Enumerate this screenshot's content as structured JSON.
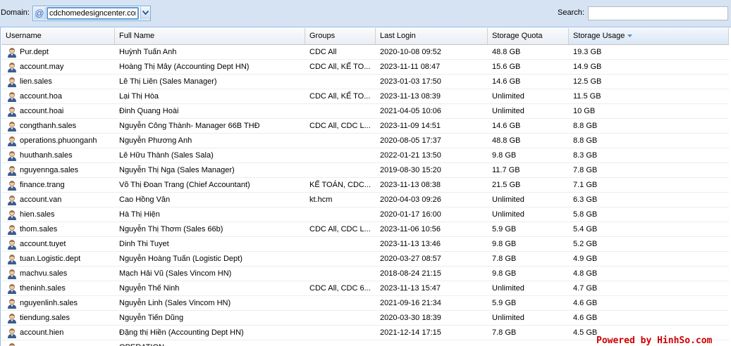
{
  "toolbar": {
    "domain_label": "Domain:",
    "domain_value": "cdchomedesigncenter.com",
    "search_label": "Search:",
    "search_value": ""
  },
  "grid": {
    "columns": {
      "username": "Username",
      "full_name": "Full Name",
      "groups": "Groups",
      "last_login": "Last Login",
      "storage_quota": "Storage Quota",
      "storage_usage": "Storage Usage"
    },
    "sorted_column": "storage_usage",
    "sort_direction": "descending",
    "rows": [
      {
        "username": "Pur.dept",
        "full_name": "Huỳnh Tuấn Anh",
        "groups": "CDC All",
        "last_login": "2020-10-08 09:52",
        "quota": "48.8 GB",
        "usage": "19.3 GB"
      },
      {
        "username": "account.may",
        "full_name": "Hoàng Thị Mây (Accounting Dept HN)",
        "groups": "CDC All, KẾ TO...",
        "last_login": "2023-11-11 08:47",
        "quota": "15.6 GB",
        "usage": "14.9 GB"
      },
      {
        "username": "lien.sales",
        "full_name": "Lê Thị Liên (Sales Manager)",
        "groups": "",
        "last_login": "2023-01-03 17:50",
        "quota": "14.6 GB",
        "usage": "12.5 GB"
      },
      {
        "username": "account.hoa",
        "full_name": "Lại Thị Hòa",
        "groups": "CDC All, KẾ TO...",
        "last_login": "2023-11-13 08:39",
        "quota": "Unlimited",
        "usage": "11.5 GB"
      },
      {
        "username": "account.hoai",
        "full_name": "Đinh Quang Hoài",
        "groups": "",
        "last_login": "2021-04-05 10:06",
        "quota": "Unlimited",
        "usage": "10 GB"
      },
      {
        "username": "congthanh.sales",
        "full_name": "Nguyễn Công Thành- Manager 66B THĐ",
        "groups": "CDC All, CDC L...",
        "last_login": "2023-11-09 14:51",
        "quota": "14.6 GB",
        "usage": "8.8 GB"
      },
      {
        "username": "operations.phuonganh",
        "full_name": "Nguyễn Phương Anh",
        "groups": "",
        "last_login": "2020-08-05 17:37",
        "quota": "48.8 GB",
        "usage": "8.8 GB"
      },
      {
        "username": "huuthanh.sales",
        "full_name": "Lê Hữu Thành (Sales Sala)",
        "groups": "",
        "last_login": "2022-01-21 13:50",
        "quota": "9.8 GB",
        "usage": "8.3 GB"
      },
      {
        "username": "nguyennga.sales",
        "full_name": "Nguyễn Thị Nga (Sales Manager)",
        "groups": "",
        "last_login": "2019-08-30 15:20",
        "quota": "11.7 GB",
        "usage": "7.8 GB"
      },
      {
        "username": "finance.trang",
        "full_name": "Võ Thị Đoan Trang (Chief Accountant)",
        "groups": "KẾ TOÁN, CDC...",
        "last_login": "2023-11-13 08:38",
        "quota": "21.5 GB",
        "usage": "7.1 GB"
      },
      {
        "username": "account.van",
        "full_name": "Cao Hồng Vân",
        "groups": "kt.hcm",
        "last_login": "2020-04-03 09:26",
        "quota": "Unlimited",
        "usage": "6.3 GB"
      },
      {
        "username": "hien.sales",
        "full_name": "Hà Thị Hiện",
        "groups": "",
        "last_login": "2020-01-17 16:00",
        "quota": "Unlimited",
        "usage": "5.8 GB"
      },
      {
        "username": "thom.sales",
        "full_name": "Nguyễn Thị Thơm (Sales 66b)",
        "groups": "CDC All, CDC L...",
        "last_login": "2023-11-06 10:56",
        "quota": "5.9 GB",
        "usage": "5.4 GB"
      },
      {
        "username": "account.tuyet",
        "full_name": "Dinh Thi Tuyet",
        "groups": "",
        "last_login": "2023-11-13 13:46",
        "quota": "9.8 GB",
        "usage": "5.2 GB"
      },
      {
        "username": "tuan.Logistic.dept",
        "full_name": "Nguyễn Hoàng Tuấn (Logistic Dept)",
        "groups": "",
        "last_login": "2020-03-27 08:57",
        "quota": "7.8 GB",
        "usage": "4.9 GB"
      },
      {
        "username": "machvu.sales",
        "full_name": "Mạch Hải Vũ (Sales Vincom HN)",
        "groups": "",
        "last_login": "2018-08-24 21:15",
        "quota": "9.8 GB",
        "usage": "4.8 GB"
      },
      {
        "username": "theninh.sales",
        "full_name": "Nguyễn Thế Ninh",
        "groups": "CDC All, CDC 6...",
        "last_login": "2023-11-13 15:47",
        "quota": "Unlimited",
        "usage": "4.7 GB"
      },
      {
        "username": "nguyenlinh.sales",
        "full_name": "Nguyễn Linh (Sales Vincom HN)",
        "groups": "",
        "last_login": "2021-09-16 21:34",
        "quota": "5.9 GB",
        "usage": "4.6 GB"
      },
      {
        "username": "tiendung.sales",
        "full_name": "Nguyễn Tiến Dũng",
        "groups": "",
        "last_login": "2020-03-30 18:39",
        "quota": "Unlimited",
        "usage": "4.6 GB"
      },
      {
        "username": "account.hien",
        "full_name": "Đặng thị Hiền (Accounting Dept HN)",
        "groups": "",
        "last_login": "2021-12-14 17:15",
        "quota": "7.8 GB",
        "usage": "4.5 GB"
      },
      {
        "username": "",
        "full_name": "OPERATION",
        "groups": "",
        "last_login": "",
        "quota": "",
        "usage": ""
      }
    ]
  },
  "watermark": "Powered by HinhSo.com",
  "colors": {
    "toolbar_bg": "#d6e3f2",
    "border": "#99bbe8",
    "watermark": "#d00000"
  }
}
